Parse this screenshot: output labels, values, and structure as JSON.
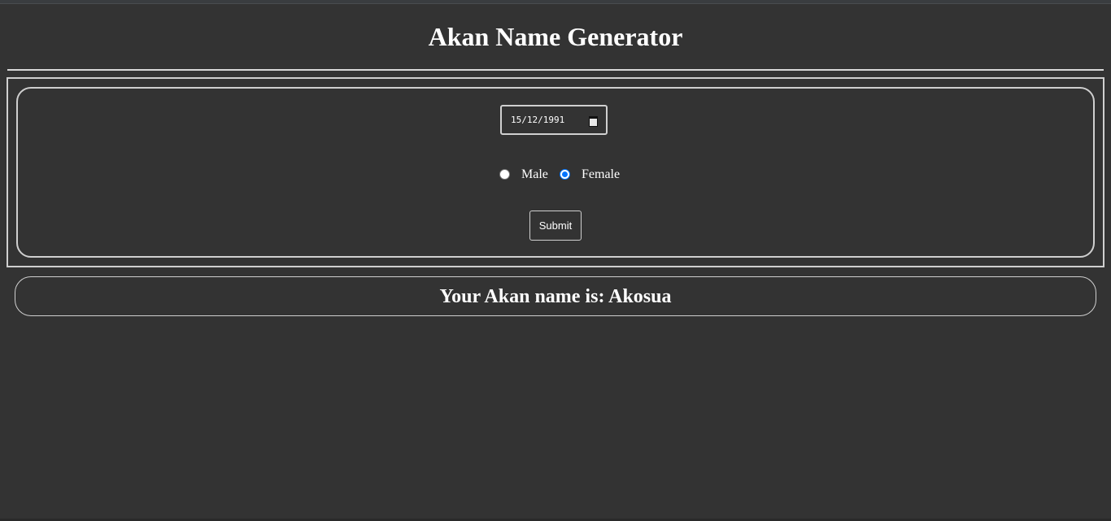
{
  "page": {
    "title": "Akan Name Generator"
  },
  "form": {
    "birth_date_value": "15/12/1991",
    "gender": {
      "options": [
        "Male",
        "Female"
      ],
      "selected": "Female"
    },
    "submit_label": "Submit"
  },
  "result": {
    "text": "Your Akan name is: Akosua"
  },
  "colors": {
    "background": "#333333",
    "text": "#ffffff",
    "border": "#cfcfcf",
    "radio_accent": "#0075ff"
  },
  "icons": {
    "date_picker": "calendar-icon"
  }
}
